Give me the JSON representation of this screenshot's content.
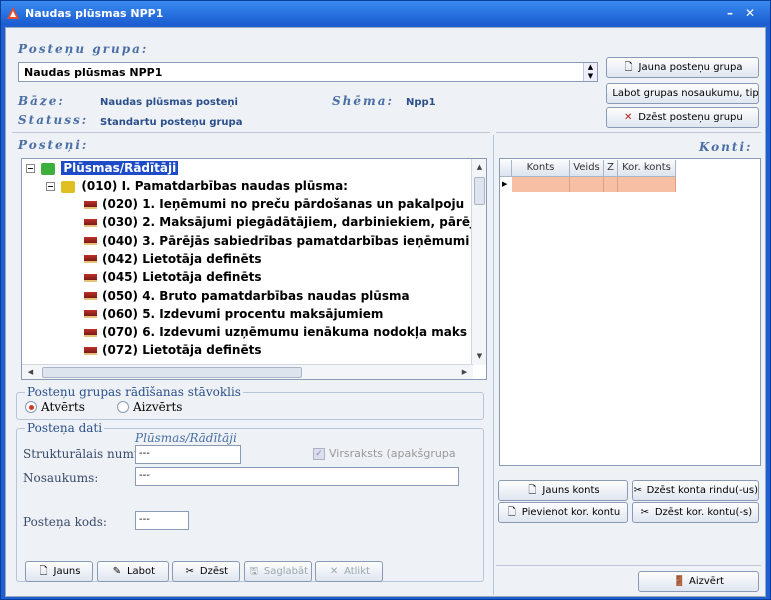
{
  "window": {
    "title": "Naudas plūsmas NPP1"
  },
  "group": {
    "label": "Posteņu grupa:",
    "selected": "Naudas plūsmas NPP1",
    "base_label": "Bāze:",
    "base_value": "Naudas plūsmas posteņi",
    "schema_label": "Shēma:",
    "schema_value": "Npp1",
    "status_label": "Statuss:",
    "status_value": "Standartu posteņu grupa"
  },
  "top_buttons": {
    "new_group": "Jauna posteņu grupa",
    "edit_group": "Labot grupas nosaukumu, tipu",
    "delete_group": "Dzēst posteņu grupu"
  },
  "postings": {
    "label": "Posteņi:",
    "root": "Plūsmas/Rādītāji",
    "section": "(010) I. Pamatdarbības naudas plūsma:",
    "items": [
      "(020) 1. Ieņēmumi no preču pārdošanas un pakalpoju",
      "(030) 2. Maksājumi piegādātājiem, darbiniekiem, pārēj",
      "(040) 3. Pārējās sabiedrības pamatdarbības ieņēmumi",
      "(042) Lietotāja definēts",
      "(045) Lietotāja definēts",
      "(050) 4. Bruto pamatdarbības naudas plūsma",
      "(060) 5. Izdevumi procentu maksājumiem",
      "(070) 6. Izdevumi uzņēmumu ienākuma nodokļa maks",
      "(072) Lietotāja definēts"
    ]
  },
  "display_state": {
    "title": "Posteņu grupas rādīšanas stāvoklis",
    "opened": "Atvērts",
    "closed": "Aizvērts",
    "selected": "opened"
  },
  "posting_data": {
    "title": "Posteņa dati",
    "path": "Plūsmas/Rādītāji",
    "struct_label": "Strukturālais numurs:",
    "struct_value": "---",
    "heading_label": "Virsraksts (apakšgrupa",
    "name_label": "Nosaukums:",
    "name_value": "---",
    "code_label": "Posteņa kods:",
    "code_value": "---"
  },
  "bottom_buttons": {
    "new": "Jauns",
    "edit": "Labot",
    "delete": "Dzēst",
    "save": "Saglabāt",
    "cancel": "Atlikt"
  },
  "accounts": {
    "label": "Konti:",
    "columns": [
      "Konts",
      "Veids",
      "Z",
      "Kor. konts"
    ],
    "new_account": "Jauns konts",
    "delete_rows": "Dzēst konta rindu(-us)",
    "add_cor": "Pievienot kor. kontu",
    "delete_cor": "Dzēst kor. kontu(-s)",
    "close": "Aizvērt"
  }
}
